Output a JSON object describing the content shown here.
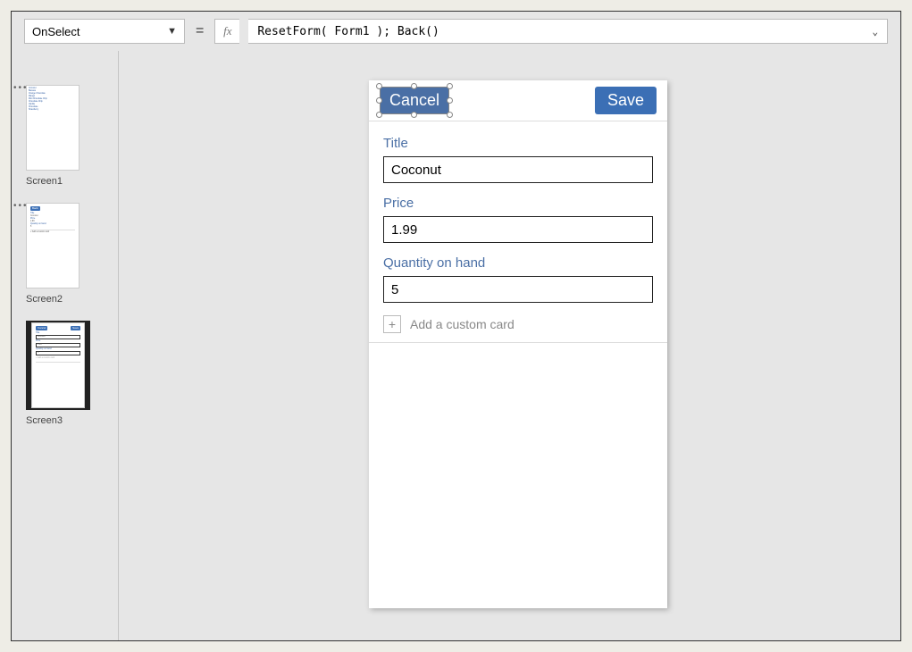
{
  "formulaBar": {
    "property": "OnSelect",
    "fx": "fx",
    "equals": "=",
    "formula": "ResetForm( Form1 ); Back()"
  },
  "thumbs": {
    "screen1": "Screen1",
    "screen2": "Screen2",
    "screen3": "Screen3",
    "dots": "•••"
  },
  "phone": {
    "header": {
      "cancel": "Cancel",
      "save": "Save"
    },
    "fields": {
      "title": {
        "label": "Title",
        "value": "Coconut"
      },
      "price": {
        "label": "Price",
        "value": "1.99"
      },
      "qty": {
        "label": "Quantity on hand",
        "value": "5"
      }
    },
    "addCard": {
      "plus": "+",
      "text": "Add a custom card"
    }
  },
  "micro": {
    "items": [
      "Coconut",
      "Banana",
      "Orange Chocolate",
      "Mango",
      "Mint Chocolate Chip",
      "Chocolate Chip",
      "Vanilla",
      "Chocolate",
      "Strawberry"
    ],
    "s3": {
      "cancel": "Cancel",
      "save": "Save",
      "t": "Title",
      "tv": "Coconut",
      "p": "Price",
      "pv": "1.99",
      "q": "Quantity on hand",
      "qv": "5",
      "add": "+ Add a custom card"
    }
  }
}
